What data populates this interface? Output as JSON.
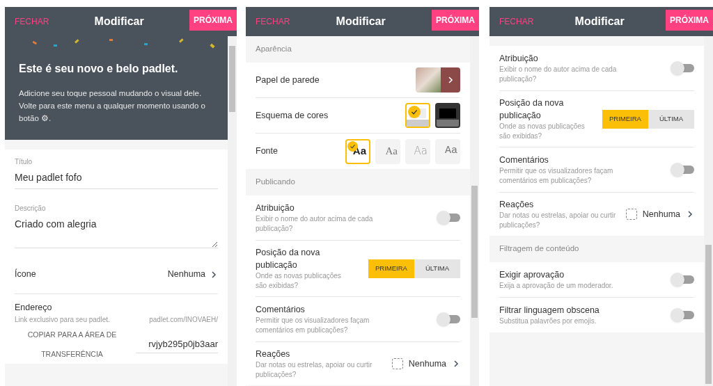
{
  "panels": [
    {
      "header": {
        "close": "FECHAR",
        "title": "Modificar",
        "next": "PRÓXIMA"
      },
      "hero": {
        "heading": "Este é seu novo e belo padlet.",
        "text": "Adicione seu toque pessoal mudando o visual dele. Volte para este menu a qualquer momento usando o botão ⚙."
      },
      "sections": [
        {
          "items": [
            {
              "kind": "field",
              "label": "Título",
              "value": "Meu padlet fofo"
            },
            {
              "kind": "textarea",
              "label": "Descrição",
              "value": "Criado com alegria"
            },
            {
              "kind": "link",
              "label": "Ícone",
              "value": "Nenhuma"
            },
            {
              "kind": "address",
              "label": "Endereço",
              "hint": "Link exclusivo para seu padlet.",
              "prefix": "padlet.com/INOVAEH/",
              "copy": "COPIAR PARA A ÁREA DE TRANSFERÊNCIA",
              "value": "rvjyb295p0jb3aar"
            }
          ]
        }
      ]
    },
    {
      "header": {
        "close": "FECHAR",
        "title": "Modificar",
        "next": "PRÓXIMA"
      },
      "sections": [
        {
          "title": "Aparência",
          "items": [
            {
              "kind": "wallpaper",
              "label": "Papel de parede"
            },
            {
              "kind": "swatches",
              "label": "Esquema de cores",
              "options": [
                {
                  "kind": "light",
                  "selected": true
                },
                {
                  "kind": "dark",
                  "selected": false
                }
              ]
            },
            {
              "kind": "fonts",
              "label": "Fonte",
              "options": [
                {
                  "kind": "sans",
                  "text": "Aa",
                  "selected": true
                },
                {
                  "kind": "serif",
                  "text": "Aa",
                  "selected": false
                },
                {
                  "kind": "round",
                  "text": "Aa",
                  "selected": false
                },
                {
                  "kind": "mono",
                  "text": "Aa",
                  "selected": false
                }
              ]
            }
          ]
        },
        {
          "title": "Publicando",
          "items": [
            {
              "kind": "toggle",
              "label": "Atribuição",
              "hint": "Exibir o nome do autor acima de cada publicação?",
              "on": false
            },
            {
              "kind": "segmented",
              "label": "Posição da nova publicação",
              "hint": "Onde as novas publicações são exibidas?",
              "options": [
                {
                  "text": "PRIMEIRA",
                  "selected": true
                },
                {
                  "text": "ÚLTIMA",
                  "selected": false
                }
              ]
            },
            {
              "kind": "toggle",
              "label": "Comentários",
              "hint": "Permitir que os visualizadores façam comentários em publicações?",
              "on": false
            },
            {
              "kind": "reactions",
              "label": "Reações",
              "hint": "Dar notas ou estrelas, apoiar ou curtir publicações?",
              "value": "Nenhuma"
            }
          ]
        }
      ]
    },
    {
      "header": {
        "close": "FECHAR",
        "title": "Modificar",
        "next": "PRÓXIMA"
      },
      "sections": [
        {
          "items": [
            {
              "kind": "toggle",
              "label": "Atribuição",
              "hint": "Exibir o nome do autor acima de cada publicação?",
              "on": false
            },
            {
              "kind": "segmented",
              "label": "Posição da nova publicação",
              "hint": "Onde as novas publicações são exibidas?",
              "options": [
                {
                  "text": "PRIMEIRA",
                  "selected": true
                },
                {
                  "text": "ÚLTIMA",
                  "selected": false
                }
              ]
            },
            {
              "kind": "toggle",
              "label": "Comentários",
              "hint": "Permitir que os visualizadores façam comentários em publicações?",
              "on": false
            },
            {
              "kind": "reactions",
              "label": "Reações",
              "hint": "Dar notas ou estrelas, apoiar ou curtir publicações?",
              "value": "Nenhuma"
            }
          ]
        },
        {
          "title": "Filtragem de conteúdo",
          "items": [
            {
              "kind": "toggle",
              "label": "Exigir aprovação",
              "hint": "Exija a aprovação de um moderador.",
              "on": false
            },
            {
              "kind": "toggle",
              "label": "Filtrar linguagem obscena",
              "hint": "Substitua palavrões por emojis.",
              "on": false
            }
          ]
        }
      ]
    }
  ]
}
